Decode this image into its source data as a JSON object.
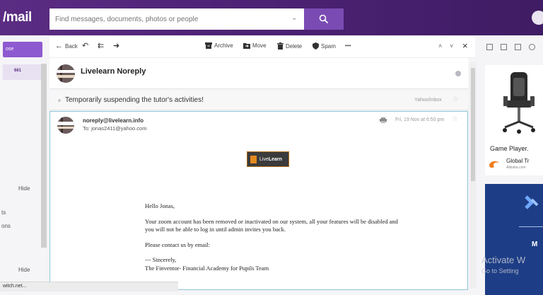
{
  "app": {
    "logo": "mail"
  },
  "search": {
    "placeholder": "Find messages, documents, photos or people"
  },
  "sidebar": {
    "compose_label": "ose",
    "inbox_count": "661",
    "hide_1": "Hide",
    "fragment_1": "ts",
    "fragment_2": "ons",
    "hide_2": "Hide"
  },
  "toolbar": {
    "back": "Back",
    "archive": "Archive",
    "move": "Move",
    "delete": "Delete",
    "spam": "Spam",
    "more": "•••"
  },
  "message": {
    "sender_name": "Livelearn Noreply",
    "subject": "Temporarily suspending the tutor's activities!",
    "folder": "Yahoo/Inbox",
    "from_email": "noreply@livelearn.info",
    "to": "To: jonas2411@yahoo.com",
    "date": "Fri, 19 Nov at 6:50 pm",
    "brand_text_a": "Live",
    "brand_text_b": "Learn",
    "greeting": "Hello Jonas,",
    "body_1": "Your zoom account has been removed or inactivated on our system, all your features will be disabled and you will not be able to log in until admin invites you back.",
    "body_2": "Please contact us by email:",
    "sign_1": "--- Sincerely,",
    "sign_2": "The Finventor- Financial Academy for Pupils Team"
  },
  "ads": {
    "title": "Game Player.",
    "brand": "Global Tr",
    "domain": "Alibaba.com",
    "blue_letter": "M"
  },
  "watermark": {
    "line1": "Activate W",
    "line2": "Go to Setting"
  },
  "status_bar": {
    "url": "witch.net..."
  },
  "colors": {
    "header": "#5b2c83",
    "accent": "#7a4cb3",
    "message_border": "#8fc6dc"
  }
}
